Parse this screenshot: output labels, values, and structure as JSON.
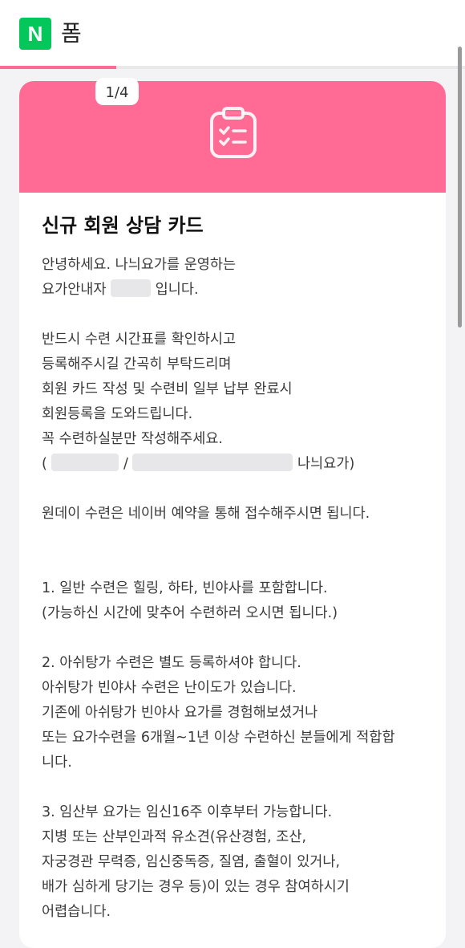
{
  "header": {
    "logo_letter": "N",
    "app_title": "폼"
  },
  "progress": {
    "fraction": 0.25
  },
  "card": {
    "page_indicator": "1/4",
    "accent_color": "#ff6b94",
    "icon": "clipboard-check-icon",
    "title": "신규 회원 상담 카드",
    "intro_line1": "안녕하세요. 나늬요가를 운영하는",
    "intro_line2_prefix": "요가안내자",
    "intro_line2_suffix": "입니다.",
    "para1": [
      "반드시 수련 시간표를 확인하시고",
      "등록해주시길 간곡히 부탁드리며",
      "회원 카드 작성 및 수련비 일부 납부 완료시",
      "회원등록을 도와드립니다.",
      "꼭 수련하실분만 작성해주세요."
    ],
    "account_open": "(",
    "account_sep": "/",
    "account_close": "나늬요가)",
    "oneday": "원데이 수련은 네이버 예약을 통해 접수해주시면 됩니다.",
    "item1": [
      "1. 일반 수련은 힐링, 하타, 빈야사를 포함합니다.",
      "(가능하신 시간에 맞추어 수련하러 오시면 됩니다.)"
    ],
    "item2": [
      "2. 아쉬탕가 수련은 별도 등록하셔야 합니다.",
      "아쉬탕가 빈야사 수련은 난이도가 있습니다.",
      "기존에 아쉬탕가 빈야사 요가를 경험해보셨거나",
      "또는 요가수련을 6개월~1년 이상 수련하신 분들에게 적합합",
      "니다."
    ],
    "item3": [
      "3. 임산부 요가는 임신16주 이후부터 가능합니다.",
      "지병 또는 산부인과적 유소견(유산경험, 조산,",
      "자궁경관 무력증, 임신중독증, 질염, 출혈이 있거나,",
      "배가 심하게 당기는 경우 등)이 있는 경우 참여하시기",
      "어렵습니다."
    ]
  }
}
